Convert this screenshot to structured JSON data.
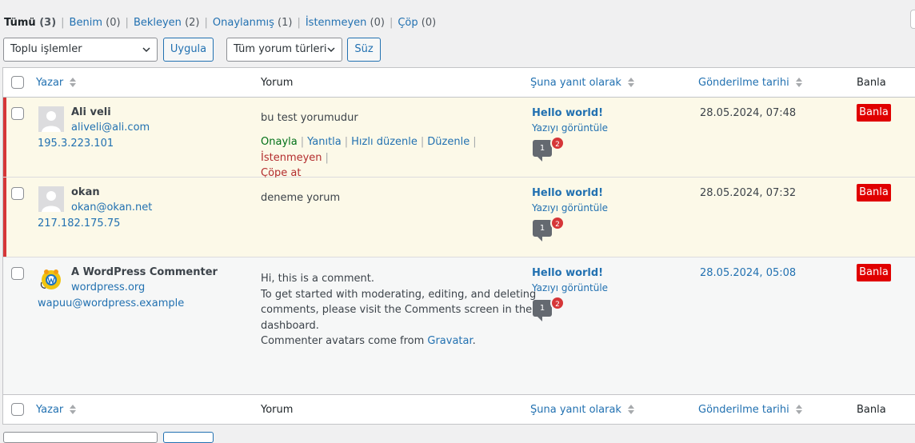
{
  "filters": [
    {
      "label": "Tümü",
      "count": "(3)",
      "current": true
    },
    {
      "label": "Benim",
      "count": "(0)"
    },
    {
      "label": "Bekleyen",
      "count": "(2)"
    },
    {
      "label": "Onaylanmış",
      "count": "(1)"
    },
    {
      "label": "İstenmeyen",
      "count": "(0)"
    },
    {
      "label": "Çöp",
      "count": "(0)"
    }
  ],
  "toolbar": {
    "bulk_actions": "Toplu işlemler",
    "apply": "Uygula",
    "comment_types": "Tüm yorum türleri",
    "filter": "Süz"
  },
  "columns": {
    "author": "Yazar",
    "comment": "Yorum",
    "in_response_to": "Şuna yanıt olarak",
    "submitted_on": "Gönderilme tarihi",
    "ban": "Banla"
  },
  "row_actions": {
    "approve": "Onayla",
    "reply": "Yanıtla",
    "quick_edit": "Hızlı düzenle",
    "edit": "Düzenle",
    "spam": "İstenmeyen",
    "trash": "Çöpe at"
  },
  "comments": [
    {
      "status": "unapproved",
      "author_name": "Ali veli",
      "author_url": "aliveli@ali.com",
      "author_ip": "195.3.223.101",
      "text": "bu test yorumudur",
      "post_title": "Hello world!",
      "view_post": "Yazıyı görüntüle",
      "approved_count": "1",
      "pending_count": "2",
      "date": "28.05.2024, 07:48",
      "ban_label": "Banla"
    },
    {
      "status": "unapproved",
      "author_name": "okan",
      "author_url": "okan@okan.net",
      "author_ip": "217.182.175.75",
      "text": "deneme yorum",
      "post_title": "Hello world!",
      "view_post": "Yazıyı görüntüle",
      "approved_count": "1",
      "pending_count": "2",
      "date": "28.05.2024, 07:32",
      "ban_label": "Banla"
    },
    {
      "status": "approved",
      "author_name": "A WordPress Commenter",
      "author_url": "wordpress.org",
      "author_ip": "wapuu@wordpress.example",
      "text_lines": [
        "Hi, this is a comment.",
        "To get started with moderating, editing, and deleting",
        "comments, please visit the Comments screen in the",
        "dashboard."
      ],
      "text_last_prefix": "Commenter avatars come from ",
      "text_last_link": "Gravatar",
      "text_last_suffix": ".",
      "post_title": "Hello world!",
      "view_post": "Yazıyı görüntüle",
      "approved_count": "1",
      "pending_count": "2",
      "date": "28.05.2024, 05:08",
      "ban_label": "Banla"
    }
  ]
}
